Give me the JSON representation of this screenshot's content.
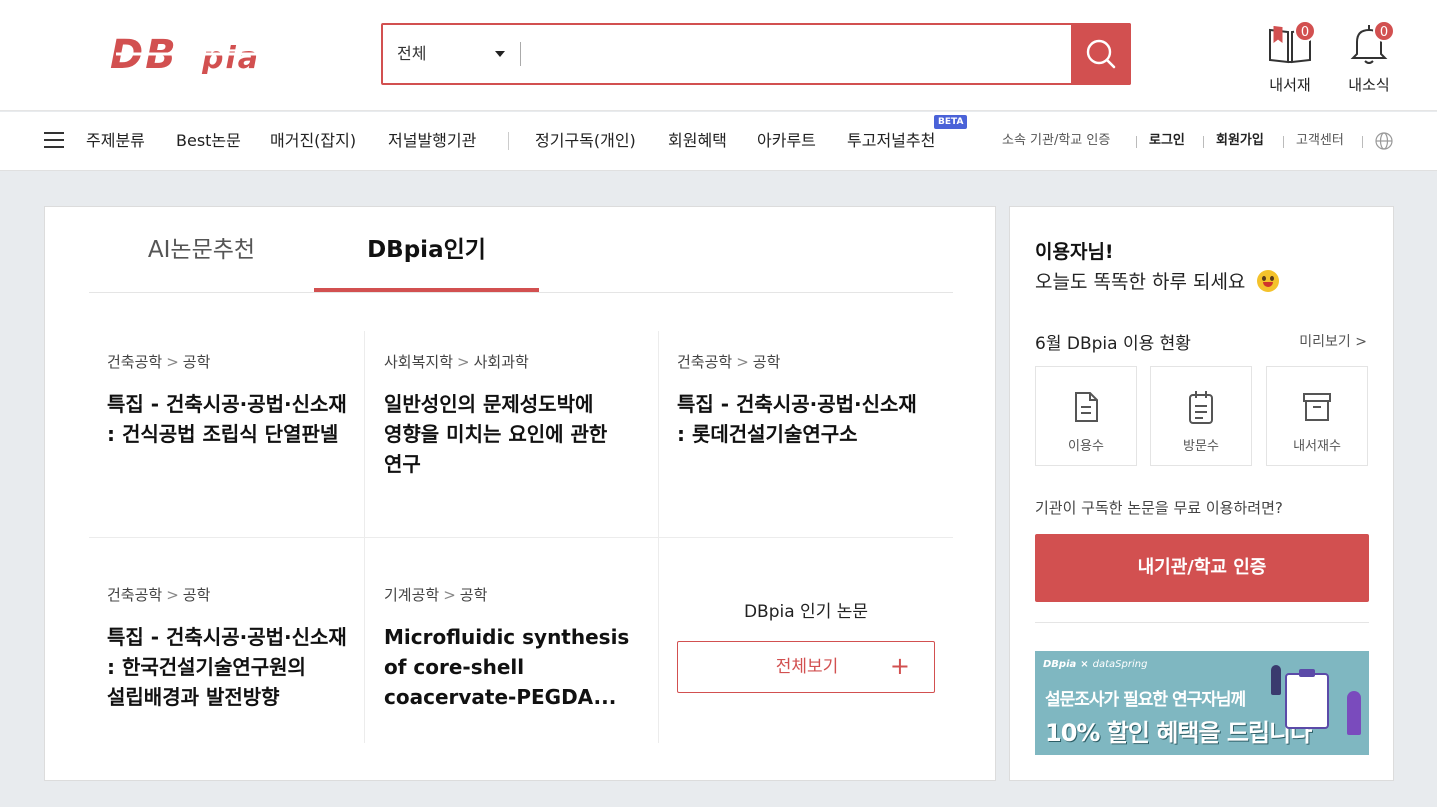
{
  "brand": {
    "logo_text": "DBpia",
    "accent": "#d25050"
  },
  "search": {
    "scope": "전체",
    "placeholder": "",
    "value": ""
  },
  "header_icons": {
    "library": {
      "label": "내서재",
      "count": "0"
    },
    "alerts": {
      "label": "내소식",
      "count": "0"
    }
  },
  "nav": {
    "items": [
      "주제분류",
      "Best논문",
      "매거진(잡지)",
      "저널발행기관",
      "정기구독(개인)",
      "회원혜택",
      "아카루트",
      "투고저널추천"
    ],
    "beta": "BETA",
    "utils": [
      "소속 기관/학교 인증",
      "로그인",
      "회원가입",
      "고객센터"
    ]
  },
  "tabs": {
    "ai": "AI논문추천",
    "popular": "DBpia인기"
  },
  "cards": [
    {
      "cat1": "건축공학",
      "cat2": "공학",
      "title": "특집 - 건축시공·공법·신소재 : 건식공법 조립식 단열판넬"
    },
    {
      "cat1": "사회복지학",
      "cat2": "사회과학",
      "title": "일반성인의 문제성도박에 영향을 미치는 요인에 관한 연구"
    },
    {
      "cat1": "건축공학",
      "cat2": "공학",
      "title": "특집 - 건축시공·공법·신소재 : 롯데건설기술연구소"
    },
    {
      "cat1": "건축공학",
      "cat2": "공학",
      "title": "특집 - 건축시공·공법·신소재 : 한국건설기술연구원의 설립배경과 발전방향"
    },
    {
      "cat1": "기계공학",
      "cat2": "공학",
      "title": "Microfluidic synthesis of core-shell coacervate-PEGDA..."
    }
  ],
  "cat_arrow": ">",
  "more": {
    "title": "DBpia 인기 논문",
    "button": "전체보기",
    "plus": "+"
  },
  "side": {
    "greet1": "이용자님!",
    "greet2": "오늘도 똑똑한 하루 되세요",
    "stat_title": "6월 DBpia 이용 현황",
    "preview": "미리보기 >",
    "stats": [
      "이용수",
      "방문수",
      "내서재수"
    ],
    "inst_q": "기관이 구독한 논문을 무료 이용하려면?",
    "inst_btn": "내기관/학교 인증",
    "banner": {
      "brand1": "DBpia",
      "x": "×",
      "brand2": "dataSpring",
      "line1": "설문조사가 필요한 연구자님께",
      "line2": "10% 할인 혜택을 드립니다"
    }
  }
}
